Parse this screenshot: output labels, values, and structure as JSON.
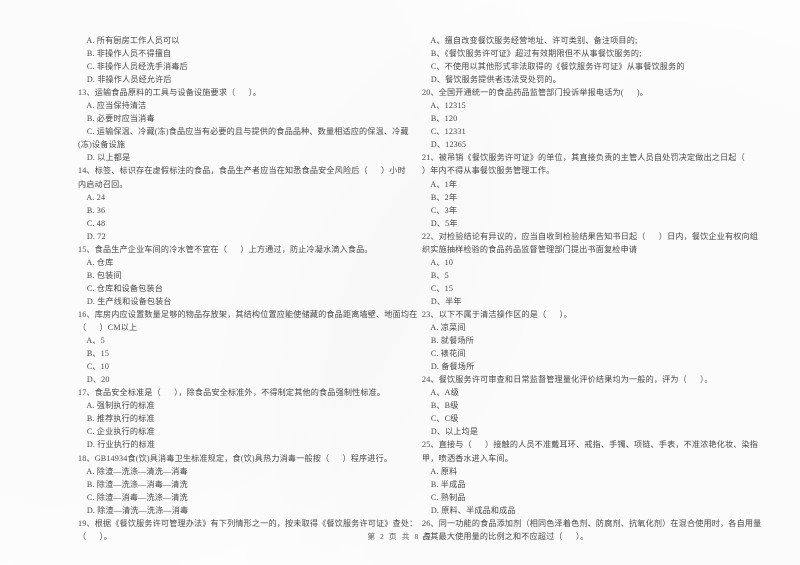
{
  "document": {
    "type": "exam-paper-scan",
    "language": "zh-CN",
    "footer": "第 2 页 共 8 页"
  },
  "left_column": {
    "lines": [
      "    A. 所有厨房工作人员可以",
      "    B. 非操作人员不得擅自",
      "    C. 非操作人员经洗手消毒后",
      "    D. 非操作人员经允许后",
      "13、运输食品原料的工具与设备设施要求（      ）。",
      "    A. 应当保持清洁",
      "    B. 必要时应当消毒",
      "    C. 运输保温、冷藏(冻)食品应当有必要的且与提供的食品品种、数量相适应的保温、冷藏",
      "(冻)设备设施",
      "    D. 以上都是",
      "14、标签、标识存在虚假标注的食品，食品生产者应当在知悉食品安全风险后（      ）小时",
      "内启动召回。",
      "    A. 24",
      "    B. 36",
      "    C. 48",
      "    D. 72",
      "15、食品生产企业车间的冷水管不宜在（      ）上方通过，防止冷凝水滴入食品。",
      "    A. 仓库",
      "    B. 包装间",
      "    C. 仓库和设备包装台",
      "    D. 生产线和设备包装台",
      "16、库房内应设置数量足够的物品存放架，其结构位置应能使储藏的食品距离墙壁、地面均在",
      "（      ）CM以上",
      "    A、5",
      "    B、15",
      "    C、10",
      "    D、20",
      "17、食品安全标准是（      ），除食品安全标准外，不得制定其他的食品强制性标准。",
      "    A. 强制执行的标准",
      "    B. 推荐执行的标准",
      "    C. 企业执行的标准",
      "    D. 行业执行的标准",
      "18、GB14934食(饮)具消毒卫生标准规定，食(饮)具热力消毒一般按（      ）程序进行。",
      "    A. 除渣—洗涤—清洗—消毒",
      "    B. 除渣—洗涤—消毒—清洗",
      "    C. 除渣—消毒—洗涤—清洗",
      "    D. 除渣—清洗—洗涤—消毒",
      "19、根据《餐饮服务许可管理办法》有下列情形之一的，按未取得《餐饮服务许可证》查处：",
      "（      ）。"
    ]
  },
  "right_column": {
    "lines": [
      "    A、擅自改变餐饮服务经营地址、许可类别、备注项目的;",
      "    B、《餐饮服务许可证》超过有效期限但不从事餐饮服务的;",
      "    C、不使用以其他形式非法取得的《餐饮服务许可证》从事餐饮服务的",
      "    D、餐饮服务提供者违法受处罚的。",
      "20、全国开通统一的食品药品监管部门投诉举报电话为(      )。",
      "    A、12315",
      "    B、120",
      "    C、12331",
      "    D、12365",
      "21、被吊销《餐饮服务许可证》的单位，其直接负责的主管人员自处罚决定做出之日起（",
      "）年内不得从事餐饮服务管理工作。",
      "    A、1年",
      "    B、2年",
      "    C、3年",
      "    D、5年",
      "22、对检验结论有异议的，应当自收到检验结果告知书日起（      ）日内，餐饮企业有权向组",
      "织实施抽样检验的食品药品监督管理部门提出书面复检申请",
      "    A、10",
      "    B、5",
      "    C、15",
      "    D、半年",
      "23、以下不属于清洁操作区的是（      ）。",
      "    A. 凉菜间",
      "    B. 就餐场所",
      "    C. 裱花间",
      "    D. 备餐场所",
      "24、餐饮服务许可审查和日常监督管理量化评价结果均为一般的，评为（      ）。",
      "    A、A级",
      "    B、B级",
      "    C、C级",
      "    D、以上均是",
      "25、直接与（      ）接触的人员不准戴耳环、戒指、手镯、项链、手表，不准浓艳化妆、染指",
      "甲，喷洒香水进入车间。",
      "    A. 原料",
      "    B. 半成品",
      "    C. 熟制品",
      "    D. 原料、半成品和成品",
      "26、同一功能的食品添加剂（相同色泽着色剂、防腐剂、抗氧化剂）在混合使用时，各自用量",
      "占其最大使用量的比例之和不应超过（      ）。"
    ]
  }
}
